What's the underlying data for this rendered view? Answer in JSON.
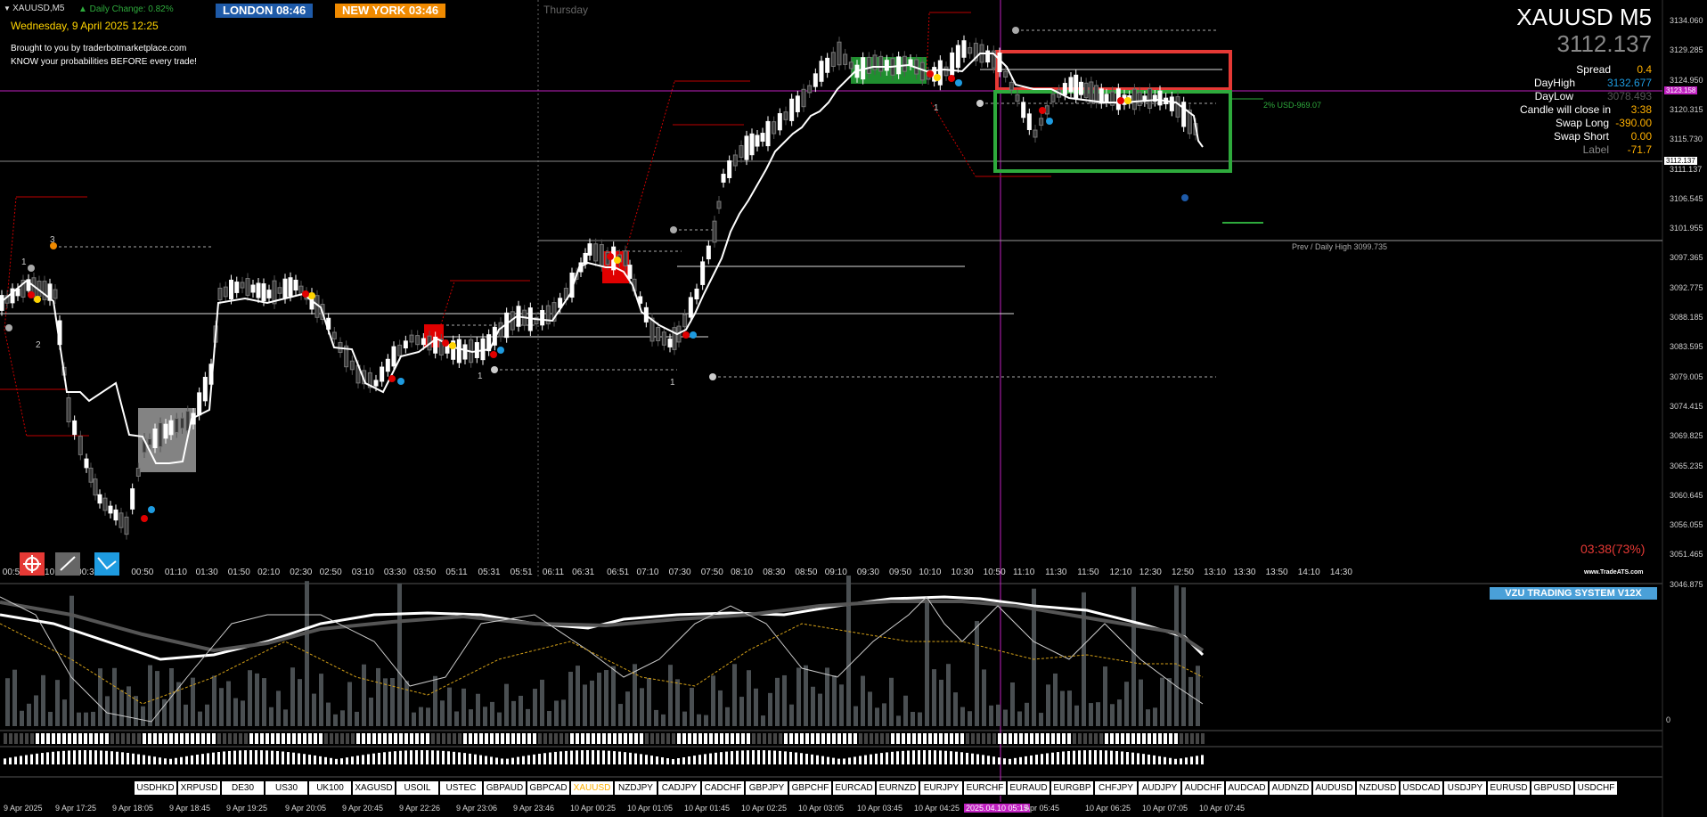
{
  "header": {
    "chart_id": "XAUUSD,M5",
    "daily_change": "▲ Daily Change: 0.82%",
    "date_line": "Wednesday, 9 April 2025 12:25",
    "sessions": [
      {
        "label": "LONDON  08:46"
      },
      {
        "label": "NEW YORK  03:46"
      }
    ],
    "promo_line1": "Brought to you by traderbotmarketplace.com",
    "promo_line2": "KNOW your probabilities BEFORE every trade!",
    "thursday_label": "Thursday"
  },
  "symbol_panel": {
    "symbol": "XAUUSD M5",
    "price": "3112.137",
    "rows": [
      {
        "label": "Spread",
        "value": "0.4"
      },
      {
        "label": "DayHigh",
        "value": "3132.677"
      },
      {
        "label": "DayLow",
        "value": "3078.493"
      },
      {
        "label": "Candle will close in",
        "value": "3:38"
      },
      {
        "label": "Swap Long",
        "value": "-390.00"
      },
      {
        "label": "Swap Short",
        "value": "0.00"
      },
      {
        "label": "Label",
        "value": "-71.7"
      }
    ],
    "countdown": "03:38(73%)",
    "watermark": "www.TradeATS.com"
  },
  "annotations": {
    "target_text": "2% USD-969.07",
    "prev_daily_high": "Prev / Daily High 3099.735",
    "current_price_tag": "3112.137",
    "magenta_tag": "3123.158"
  },
  "price_axis": [
    "3134.060",
    "3129.285",
    "3124.950",
    "3120.315",
    "3115.730",
    "3111.137",
    "3106.545",
    "3101.955",
    "3097.365",
    "3092.775",
    "3088.185",
    "3083.595",
    "3079.005",
    "3074.415",
    "3069.825",
    "3065.235",
    "3060.645",
    "3056.055",
    "3051.465",
    "3046.875"
  ],
  "time_axis": [
    "00:50",
    "01:10",
    "00:30",
    "00:50",
    "01:10",
    "01:30",
    "01:50",
    "02:10",
    "02:30",
    "02:50",
    "03:10",
    "03:30",
    "03:50",
    "05:11",
    "05:31",
    "05:51",
    "06:11",
    "06:31",
    "06:51",
    "07:10",
    "07:30",
    "07:50",
    "08:10",
    "08:30",
    "08:50",
    "09:10",
    "09:30",
    "09:50",
    "10:10",
    "10:30",
    "10:50",
    "11:10",
    "11:30",
    "11:50",
    "12:10",
    "12:30",
    "12:50",
    "13:10",
    "13:30",
    "13:50",
    "14:10",
    "14:30"
  ],
  "indicator": {
    "title": "VZU TRADING SYSTEM V12X",
    "zero_label": "0"
  },
  "symbols": [
    "USDHKD",
    "XRPUSD",
    "DE30",
    "US30",
    "UK100",
    "XAGUSD",
    "USOIL",
    "USTEC",
    "GBPAUD",
    "GBPCAD",
    "XAUUSD",
    "NZDJPY",
    "CADJPY",
    "CADCHF",
    "GBPJPY",
    "GBPCHF",
    "EURCAD",
    "EURNZD",
    "EURJPY",
    "EURCHF",
    "EURAUD",
    "EURGBP",
    "CHFJPY",
    "AUDJPY",
    "AUDCHF",
    "AUDCAD",
    "AUDNZD",
    "AUDUSD",
    "NZDUSD",
    "USDCAD",
    "USDJPY",
    "EURUSD",
    "GBPUSD",
    "USDCHF"
  ],
  "active_symbol": "XAUUSD",
  "bottom_time_axis": [
    "9 Apr 2025",
    "9 Apr 17:25",
    "9 Apr 18:05",
    "9 Apr 18:45",
    "9 Apr 19:25",
    "9 Apr 20:05",
    "9 Apr 20:45",
    "9 Apr 22:26",
    "9 Apr 23:06",
    "9 Apr 23:46",
    "10 Apr 00:25",
    "10 Apr 01:05",
    "10 Apr 01:45",
    "10 Apr 02:25",
    "10 Apr 03:05",
    "10 Apr 03:45",
    "10 Apr 04:25",
    "2025.04.10 05:15",
    "Apr 05:45",
    "10 Apr 06:25",
    "10 Apr 07:05",
    "10 Apr 07:45"
  ],
  "colors": {
    "background": "#000000",
    "candle": "#ffffff",
    "accent_red": "#e53935",
    "accent_green": "#2eaa3c",
    "magenta": "#d020d0",
    "session_blue": "#1e5aa8",
    "session_orange": "#f08a00",
    "label_gold": "#ffb000"
  }
}
